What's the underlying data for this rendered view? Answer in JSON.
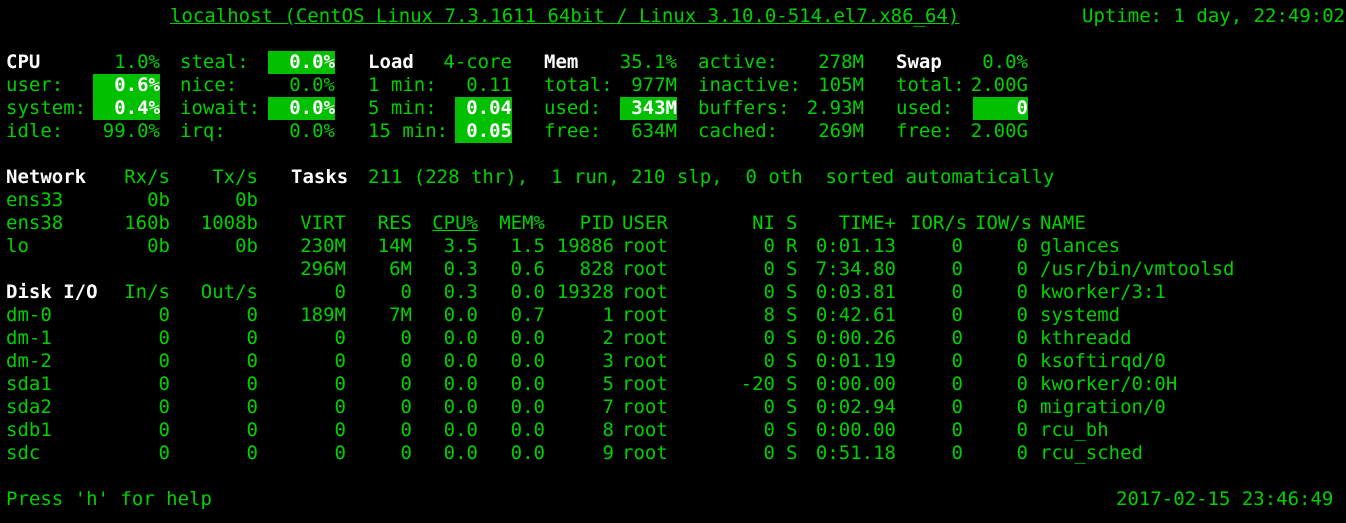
{
  "header": {
    "host": "localhost (CentOS Linux 7.3.1611 64bit / Linux 3.10.0-514.el7.x86_64)",
    "uptime": "Uptime: 1 day, 22:49:02"
  },
  "colors": {
    "background": "#000000",
    "text": "#00d000",
    "highlight": "#00c000",
    "title": "#ffffff"
  },
  "cpu": {
    "title": "CPU",
    "total": "1.0%",
    "user_label": "user:",
    "user": "0.6%",
    "system_label": "system:",
    "system": "0.4%",
    "idle_label": "idle:",
    "idle": "99.0%",
    "steal_label": "steal:",
    "steal": "0.0%",
    "nice_label": "nice:",
    "nice": "0.0%",
    "iowait_label": "iowait:",
    "iowait": "0.0%",
    "irq_label": "irq:",
    "irq": "0.0%"
  },
  "load": {
    "title": "Load",
    "cores": "4-core",
    "min1_label": "1 min:",
    "min1": "0.11",
    "min5_label": "5 min:",
    "min5": "0.04",
    "min15_label": "15 min:",
    "min15": "0.05"
  },
  "mem": {
    "title": "Mem",
    "percent": "35.1%",
    "total_label": "total:",
    "total": "977M",
    "used_label": "used:",
    "used": "343M",
    "free_label": "free:",
    "free": "634M",
    "active_label": "active:",
    "active": "278M",
    "inactive_label": "inactive:",
    "inactive": "105M",
    "buffers_label": "buffers:",
    "buffers": "2.93M",
    "cached_label": "cached:",
    "cached": "269M"
  },
  "swap": {
    "title": "Swap",
    "percent": "0.0%",
    "total_label": "total:",
    "total": "2.00G",
    "used_label": "used:",
    "used": "0",
    "free_label": "free:",
    "free": "2.00G"
  },
  "network": {
    "title": "Network",
    "rx_header": "Rx/s",
    "tx_header": "Tx/s",
    "interfaces": [
      {
        "name": "ens33",
        "rx": "0b",
        "tx": "0b"
      },
      {
        "name": "ens38",
        "rx": "160b",
        "tx": "1008b"
      },
      {
        "name": "lo",
        "rx": "0b",
        "tx": "0b"
      }
    ]
  },
  "disk": {
    "title": "Disk I/O",
    "in_header": "In/s",
    "out_header": "Out/s",
    "devices": [
      {
        "name": "dm-0",
        "in": "0",
        "out": "0"
      },
      {
        "name": "dm-1",
        "in": "0",
        "out": "0"
      },
      {
        "name": "dm-2",
        "in": "0",
        "out": "0"
      },
      {
        "name": "sda1",
        "in": "0",
        "out": "0"
      },
      {
        "name": "sda2",
        "in": "0",
        "out": "0"
      },
      {
        "name": "sdb1",
        "in": "0",
        "out": "0"
      },
      {
        "name": "sdc",
        "in": "0",
        "out": "0"
      }
    ]
  },
  "tasks": {
    "title": "Tasks",
    "summary": "211 (228 thr),  1 run, 210 slp,  0 oth  sorted automatically"
  },
  "processes": {
    "headers": {
      "virt": "VIRT",
      "res": "RES",
      "cpu": "CPU%",
      "mem": "MEM%",
      "pid": "PID",
      "user": "USER",
      "ni": "NI",
      "s": "S",
      "time": "TIME+",
      "ior": "IOR/s",
      "iow": "IOW/s",
      "name": "NAME"
    },
    "rows": [
      {
        "virt": "230M",
        "res": "14M",
        "cpu": "3.5",
        "mem": "1.5",
        "pid": "19886",
        "user": "root",
        "ni": "0",
        "s": "R",
        "time": "0:01.13",
        "ior": "0",
        "iow": "0",
        "name": "glances"
      },
      {
        "virt": "296M",
        "res": "6M",
        "cpu": "0.3",
        "mem": "0.6",
        "pid": "828",
        "user": "root",
        "ni": "0",
        "s": "S",
        "time": "7:34.80",
        "ior": "0",
        "iow": "0",
        "name": "/usr/bin/vmtoolsd"
      },
      {
        "virt": "0",
        "res": "0",
        "cpu": "0.3",
        "mem": "0.0",
        "pid": "19328",
        "user": "root",
        "ni": "0",
        "s": "S",
        "time": "0:03.81",
        "ior": "0",
        "iow": "0",
        "name": "kworker/3:1"
      },
      {
        "virt": "189M",
        "res": "7M",
        "cpu": "0.0",
        "mem": "0.7",
        "pid": "1",
        "user": "root",
        "ni": "8",
        "s": "S",
        "time": "0:42.61",
        "ior": "0",
        "iow": "0",
        "name": "systemd"
      },
      {
        "virt": "0",
        "res": "0",
        "cpu": "0.0",
        "mem": "0.0",
        "pid": "2",
        "user": "root",
        "ni": "0",
        "s": "S",
        "time": "0:00.26",
        "ior": "0",
        "iow": "0",
        "name": "kthreadd"
      },
      {
        "virt": "0",
        "res": "0",
        "cpu": "0.0",
        "mem": "0.0",
        "pid": "3",
        "user": "root",
        "ni": "0",
        "s": "S",
        "time": "0:01.19",
        "ior": "0",
        "iow": "0",
        "name": "ksoftirqd/0"
      },
      {
        "virt": "0",
        "res": "0",
        "cpu": "0.0",
        "mem": "0.0",
        "pid": "5",
        "user": "root",
        "ni": "-20",
        "s": "S",
        "time": "0:00.00",
        "ior": "0",
        "iow": "0",
        "name": "kworker/0:0H"
      },
      {
        "virt": "0",
        "res": "0",
        "cpu": "0.0",
        "mem": "0.0",
        "pid": "7",
        "user": "root",
        "ni": "0",
        "s": "S",
        "time": "0:02.94",
        "ior": "0",
        "iow": "0",
        "name": "migration/0"
      },
      {
        "virt": "0",
        "res": "0",
        "cpu": "0.0",
        "mem": "0.0",
        "pid": "8",
        "user": "root",
        "ni": "0",
        "s": "S",
        "time": "0:00.00",
        "ior": "0",
        "iow": "0",
        "name": "rcu_bh"
      },
      {
        "virt": "0",
        "res": "0",
        "cpu": "0.0",
        "mem": "0.0",
        "pid": "9",
        "user": "root",
        "ni": "0",
        "s": "S",
        "time": "0:51.18",
        "ior": "0",
        "iow": "0",
        "name": "rcu_sched"
      }
    ]
  },
  "footer": {
    "help": "Press 'h' for help",
    "datetime": "2017-02-15 23:46:49"
  }
}
